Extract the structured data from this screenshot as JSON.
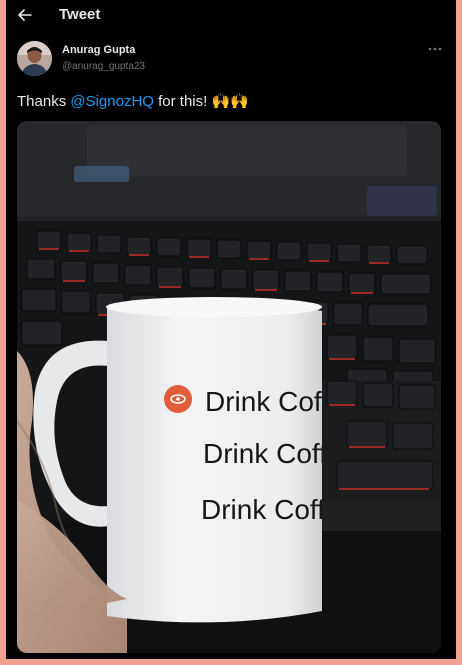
{
  "header": {
    "title": "Tweet"
  },
  "author": {
    "name": "Anurag Gupta",
    "handle": "@anurag_gupta23"
  },
  "tweet": {
    "text_before": "Thanks ",
    "mention": "@SignozHQ",
    "text_after": " for this! 🙌🙌"
  },
  "photo": {
    "mug_lines": [
      "Drink Coffe",
      "Drink Coffe",
      "Drink Coffe"
    ]
  },
  "icons": {
    "back": "arrow-left-icon",
    "more": "more-horizontal-icon",
    "mug_logo": "signoz-eye-icon"
  },
  "colors": {
    "background": "#000000",
    "mention": "#1d9bf0",
    "frame": "#f2a08f"
  }
}
